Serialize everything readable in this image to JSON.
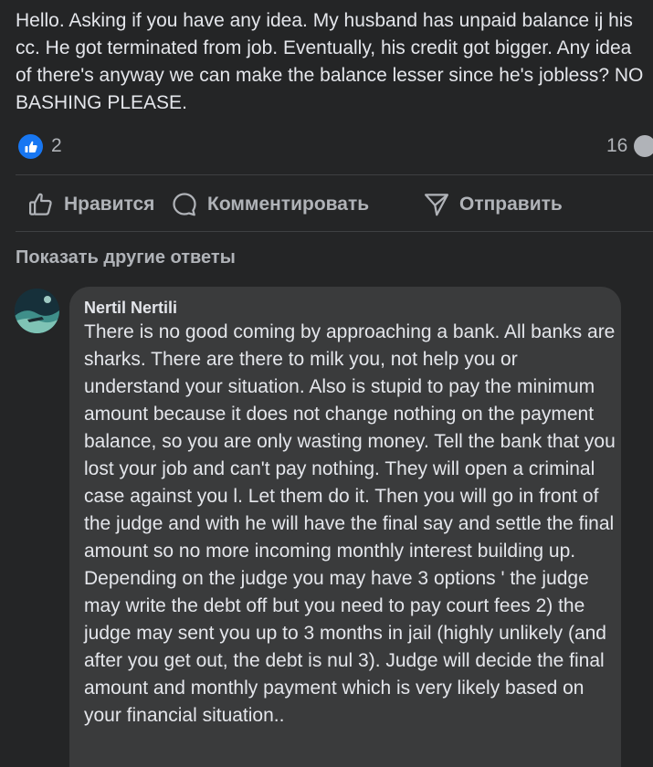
{
  "post": {
    "text": "Hello. Asking if you have any idea. My husband has unpaid balance ij his cc. He got terminated from job. Eventually, his credit got bigger. Any idea of there's anyway we can make the balance lesser since he's jobless? NO BASHING PLEASE."
  },
  "reactions": {
    "like_count": "2",
    "comment_count": "16"
  },
  "actions": {
    "like_label": "Нравится",
    "comment_label": "Комментировать",
    "share_label": "Отправить"
  },
  "more_replies_label": "Показать другие ответы",
  "comment": {
    "author": "Nertil Nertili",
    "text": "There is no good coming by approaching a bank. All banks are sharks. There are there to milk you, not help you or understand your situation. Also is stupid to pay the minimum amount because it does not change nothing on the payment balance, so you are only wasting money. Tell the bank that you lost your job and can't pay nothing. They will open a criminal case against you l. Let them do it. Then you will go in front of the judge and with he will have the final say and settle the final amount so no more incoming monthly interest building up. Depending on the judge you may have 3 options ' the judge may write the debt off but you need to pay court fees 2) the judge may sent you up to 3 months in jail (highly unlikely (and after you get out, the debt is nul 3). Judge will decide the final amount and monthly payment which is very likely based on your financial situation.."
  },
  "colors": {
    "background": "#242526",
    "bubble": "#3a3b3c",
    "text_primary": "#e4e6eb",
    "text_secondary": "#b0b3b8",
    "like_blue": "#1877f2"
  },
  "icons": {
    "like_badge": "thumbs-up-icon",
    "like_action": "thumbs-up-outline-icon",
    "comment_action": "speech-bubble-icon",
    "share_action": "send-arrow-icon"
  }
}
